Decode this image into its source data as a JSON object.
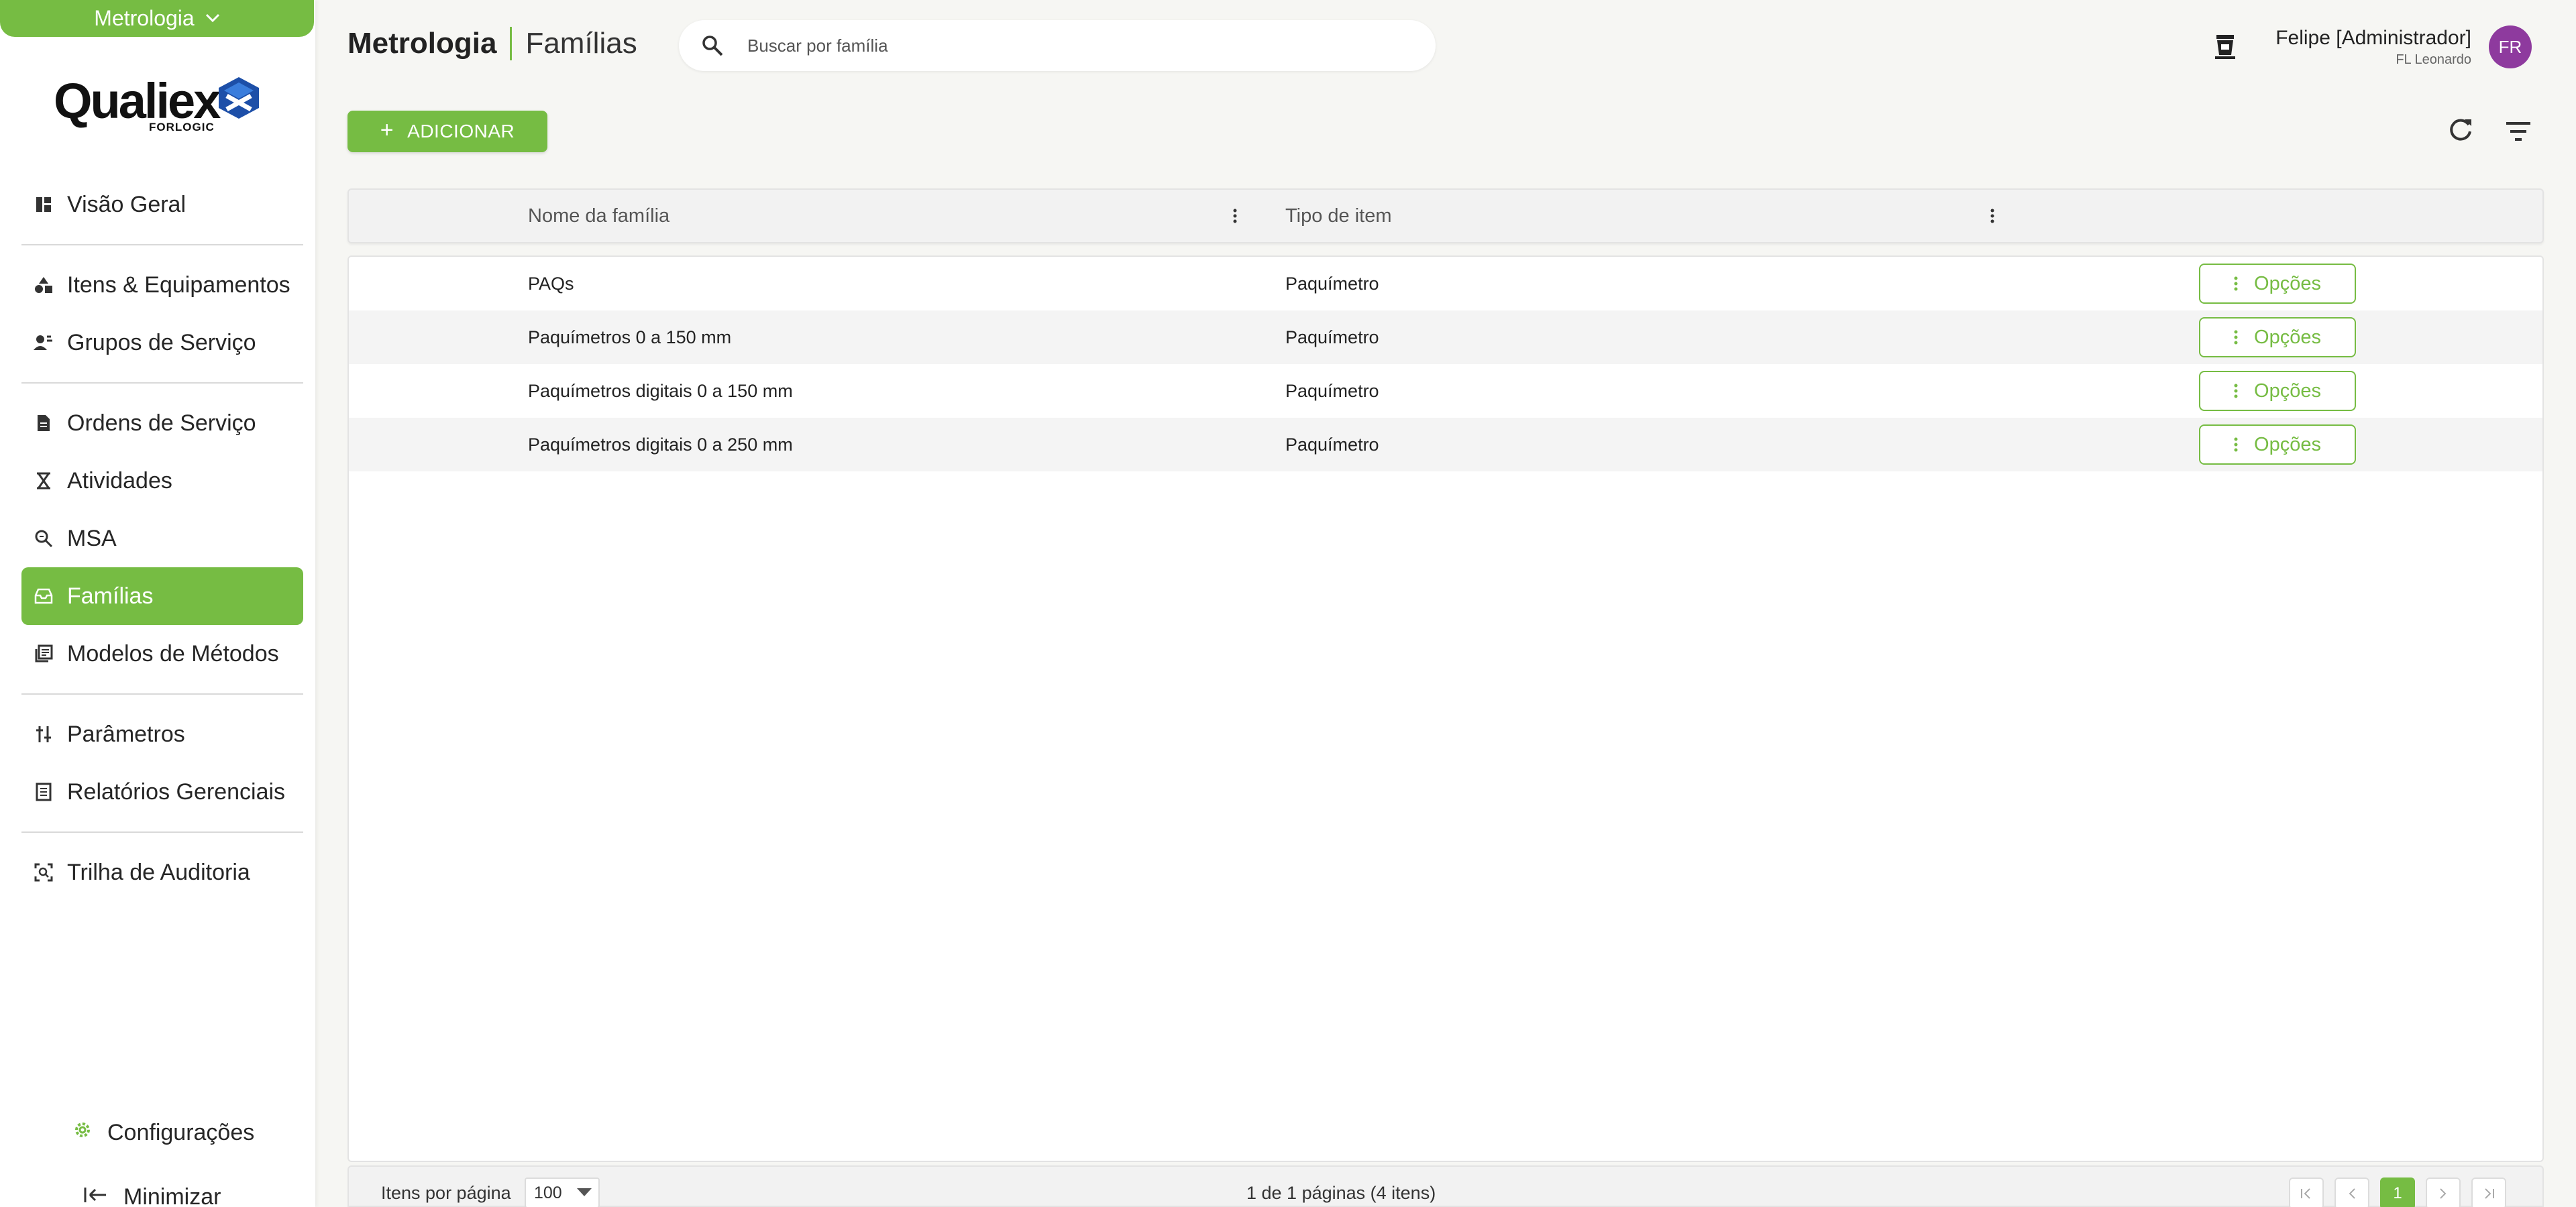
{
  "sidebar": {
    "module": "Metrologia",
    "logo": {
      "brand": "Qualiex",
      "sub": "FORLOGIC"
    },
    "nav": [
      {
        "label": "Visão Geral",
        "icon": "dashboard-icon"
      },
      {
        "label": "Itens & Equipamentos",
        "icon": "shapes-icon"
      },
      {
        "label": "Grupos de Serviço",
        "icon": "user-group-icon"
      },
      {
        "label": "Ordens de Serviço",
        "icon": "document-icon"
      },
      {
        "label": "Atividades",
        "icon": "hourglass-icon"
      },
      {
        "label": "MSA",
        "icon": "zoom-icon"
      },
      {
        "label": "Famílias",
        "icon": "drawer-icon",
        "active": true
      },
      {
        "label": "Modelos de Métodos",
        "icon": "library-icon"
      },
      {
        "label": "Parâmetros",
        "icon": "sliders-icon"
      },
      {
        "label": "Relatórios Gerenciais",
        "icon": "report-icon"
      },
      {
        "label": "Trilha de Auditoria",
        "icon": "audit-icon"
      }
    ],
    "settings_label": "Configurações",
    "minimize_label": "Minimizar"
  },
  "header": {
    "module": "Metrologia",
    "page": "Famílias",
    "search_placeholder": "Buscar por família",
    "user_name": "Felipe [Administrador]",
    "user_org": "FL Leonardo",
    "avatar_initials": "FR"
  },
  "toolbar": {
    "add_label": "ADICIONAR"
  },
  "grid": {
    "columns": [
      "Nome da família",
      "Tipo de item"
    ],
    "rows": [
      {
        "name": "PAQs",
        "type": "Paquímetro",
        "action": "Opções"
      },
      {
        "name": "Paquímetros 0 a 150 mm",
        "type": "Paquímetro",
        "action": "Opções"
      },
      {
        "name": "Paquímetros digitais 0 a 150 mm",
        "type": "Paquímetro",
        "action": "Opções"
      },
      {
        "name": "Paquímetros digitais 0 a 250 mm",
        "type": "Paquímetro",
        "action": "Opções"
      }
    ]
  },
  "footer": {
    "items_per_page_label": "Itens por página",
    "items_per_page": "100",
    "page_info": "1 de 1 páginas (4 itens)",
    "current_page": "1"
  },
  "colors": {
    "accent": "#76bc43",
    "avatar": "#8e3a9e"
  }
}
